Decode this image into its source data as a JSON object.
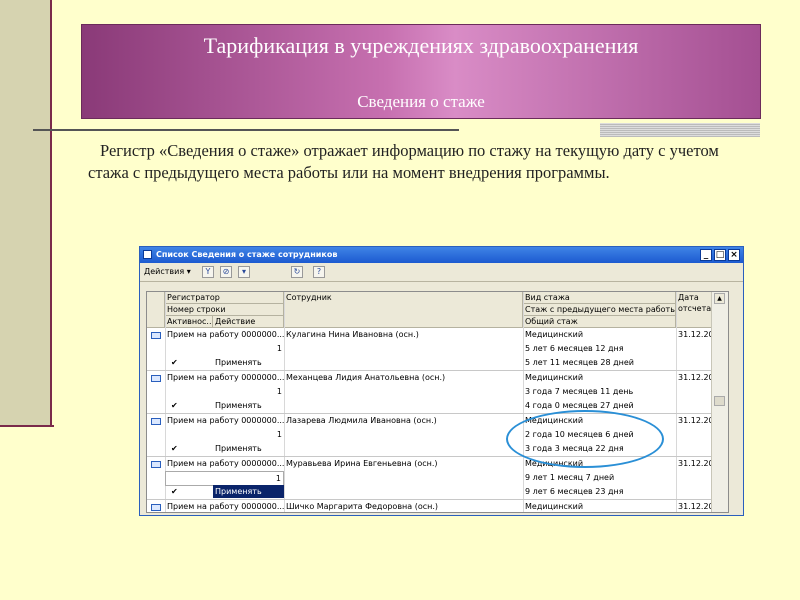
{
  "slide": {
    "title": "Тарификация в учреждениях здравоохранения",
    "subtitle": "Сведения о стаже",
    "body": "Регистр «Сведения о стаже» отражает информацию по стажу на текущую дату с учетом стажа с предыдущего места работы или на момент внедрения программы."
  },
  "window": {
    "title": "Список Сведения о стаже сотрудников",
    "buttons": {
      "minimize": "_",
      "maximize": "□",
      "close": "×"
    },
    "toolbar": {
      "actions_label": "Действия ▾",
      "icons": [
        "filter-icon",
        "filter-clear-icon",
        "filter-settings-icon",
        "refresh-icon",
        "help-icon"
      ]
    },
    "columns": {
      "registrator": "Регистратор",
      "row_number": "Номер строки",
      "active": "Активнос...",
      "action": "Действие",
      "employee": "Сотрудник",
      "experience_type": "Вид стажа",
      "prev_experience": "Стаж с предыдущего места работы",
      "total_experience": "Общий стаж",
      "date": "Дата",
      "date_sub": "отсчета"
    },
    "rows": [
      {
        "doc": "Прием на работу 0000000...",
        "num": "1",
        "action": "Применять",
        "employee": "Кулагина Нина Ивановна (осн.)",
        "type": "Медицинский",
        "prev": "5 лет 6 месяцев 12 дня",
        "total": "5 лет 11 месяцев 28 дней",
        "date": "31.12.20..."
      },
      {
        "doc": "Прием на работу 0000000...",
        "num": "1",
        "action": "Применять",
        "employee": "Механцева Лидия Анатольевна (осн.)",
        "type": "Медицинский",
        "prev": "3 года 7 месяцев 11 день",
        "total": "4 года 0 месяцев 27 дней",
        "date": "31.12.20..."
      },
      {
        "doc": "Прием на работу 0000000...",
        "num": "1",
        "action": "Применять",
        "employee": "Лазарева Людмила Ивановна (осн.)",
        "type": "Медицинский",
        "prev": "2 года 10 месяцев 6 дней",
        "total": "3 года 3 месяца 22 дня",
        "date": "31.12.20..."
      },
      {
        "doc": "Прием на работу 0000000...",
        "num": "1",
        "action": "Применять",
        "employee": "Муравьева Ирина Евгеньевна (осн.)",
        "type": "Медицинский",
        "prev": "9 лет 1 месяц 7 дней",
        "total": "9 лет 6 месяцев 23 дня",
        "date": "31.12.20..."
      },
      {
        "doc": "Прием на работу 0000000...",
        "num": "",
        "action": "",
        "employee": "Шичко Маргарита Федоровна (осн.)",
        "type": "Медицинский",
        "prev": "",
        "total": "",
        "date": "31.12.20..."
      }
    ],
    "selected_row_index": 3
  },
  "colors": {
    "background": "#ffffcc",
    "header_gradient_start": "#8a3a78",
    "header_gradient_mid": "#d98cc6",
    "window_titlebar": "#1c5ad0",
    "selection": "#0a246a",
    "highlight_ellipse": "#2a8fd6"
  }
}
